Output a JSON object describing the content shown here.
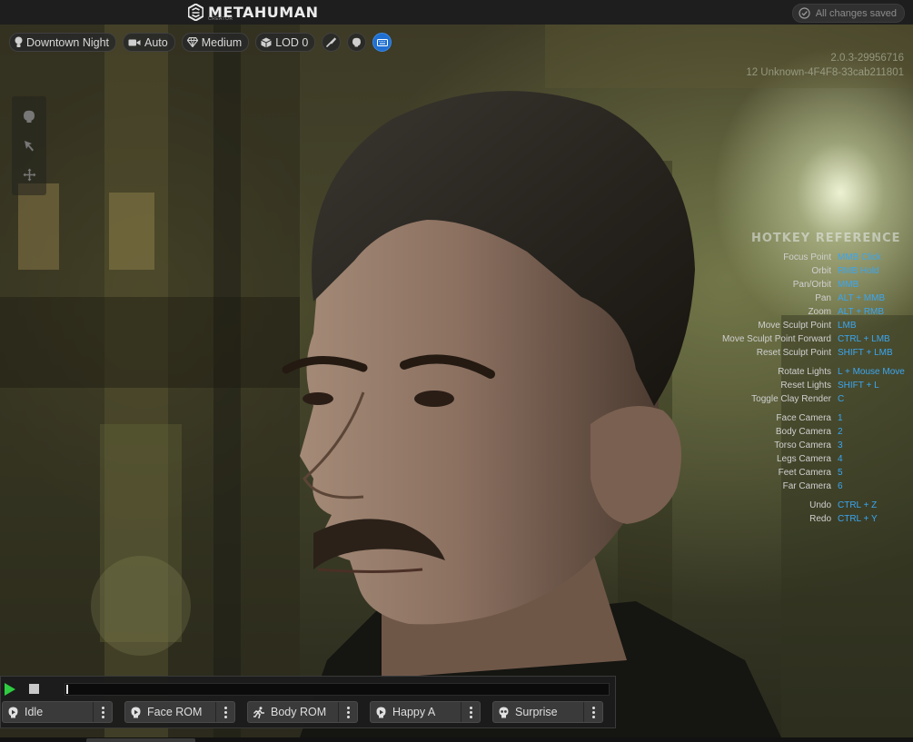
{
  "app": {
    "logo_text": "METAHUMAN",
    "logo_sub": "CREATOR",
    "save_status": "All changes saved"
  },
  "toolbar": {
    "lighting": "Downtown Night",
    "camera": "Auto",
    "quality": "Medium",
    "lod": "LOD 0"
  },
  "version": {
    "line1": "2.0.3-29956716",
    "line2": "12 Unknown-4F4F8-33cab211801"
  },
  "hotkeys": {
    "title": "HOTKEY REFERENCE",
    "groups": [
      [
        {
          "label": "Focus Point",
          "key": "MMB Click"
        },
        {
          "label": "Orbit",
          "key": "RMB Hold"
        },
        {
          "label": "Pan/Orbit",
          "key": "MMB"
        },
        {
          "label": "Pan",
          "key": "ALT + MMB"
        },
        {
          "label": "Zoom",
          "key": "ALT + RMB"
        },
        {
          "label": "Move Sculpt Point",
          "key": "LMB"
        },
        {
          "label": "Move Sculpt Point Forward",
          "key": "CTRL + LMB"
        },
        {
          "label": "Reset Sculpt Point",
          "key": "SHIFT + LMB"
        }
      ],
      [
        {
          "label": "Rotate Lights",
          "key": "L + Mouse Move"
        },
        {
          "label": "Reset Lights",
          "key": "SHIFT + L"
        },
        {
          "label": "Toggle Clay Render",
          "key": "C"
        }
      ],
      [
        {
          "label": "Face Camera",
          "key": "1"
        },
        {
          "label": "Body Camera",
          "key": "2"
        },
        {
          "label": "Torso Camera",
          "key": "3"
        },
        {
          "label": "Legs Camera",
          "key": "4"
        },
        {
          "label": "Feet Camera",
          "key": "5"
        },
        {
          "label": "Far Camera",
          "key": "6"
        }
      ],
      [
        {
          "label": "Undo",
          "key": "CTRL + Z"
        },
        {
          "label": "Redo",
          "key": "CTRL + Y"
        }
      ]
    ]
  },
  "animations": [
    {
      "label": "Idle",
      "icon": "face-icon"
    },
    {
      "label": "Face ROM",
      "icon": "face-icon"
    },
    {
      "label": "Body ROM",
      "icon": "running-figure-icon"
    },
    {
      "label": "Happy A",
      "icon": "face-icon"
    },
    {
      "label": "Surprise",
      "icon": "skull-icon"
    }
  ],
  "player": {
    "progress": 0.0
  }
}
